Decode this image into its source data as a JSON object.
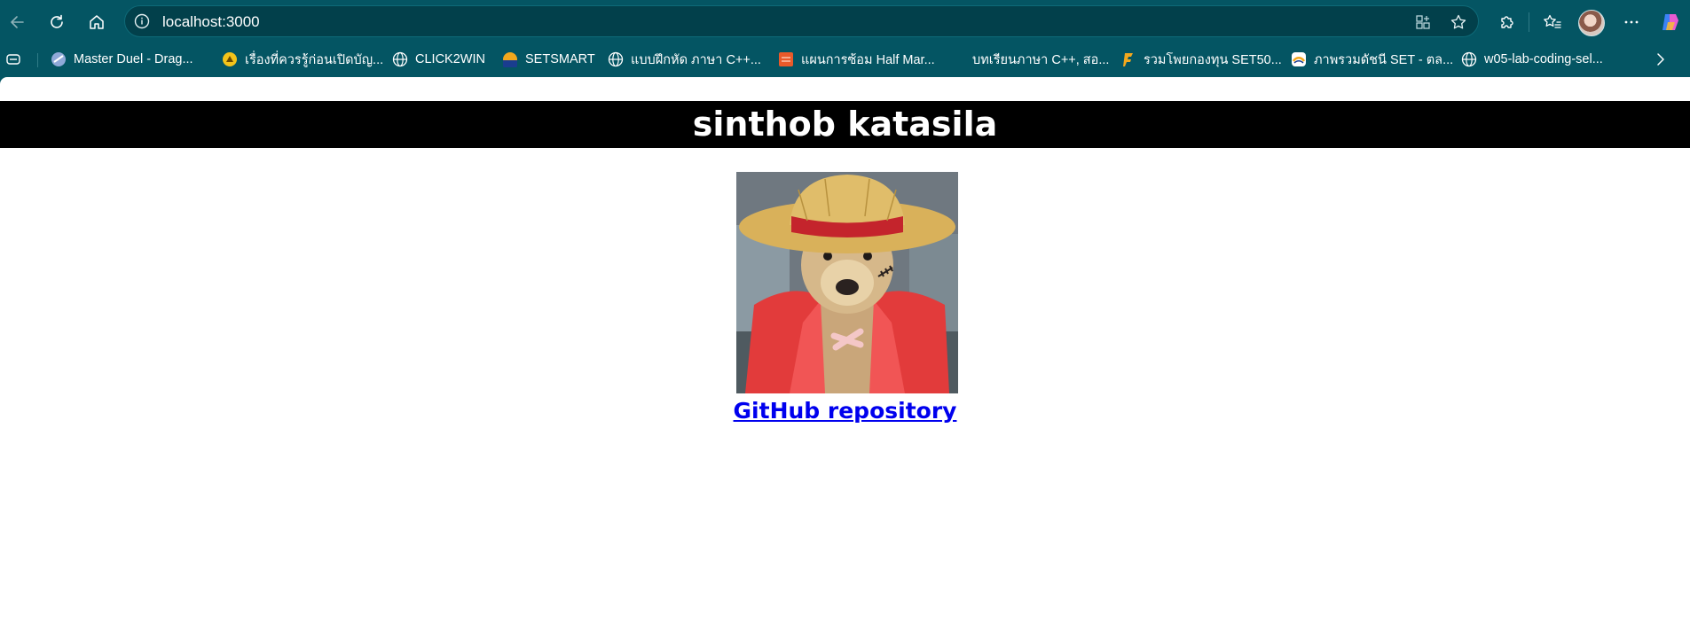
{
  "browser": {
    "url": "localhost:3000",
    "bookmarks": [
      {
        "label": "Master Duel - Drag...",
        "icon": "game-icon"
      },
      {
        "label": "เรื่องที่ควรรู้ก่อนเปิดบัญ...",
        "icon": "bank-icon"
      },
      {
        "label": "CLICK2WIN",
        "icon": "globe-icon"
      },
      {
        "label": "SETSMART",
        "icon": "set-icon"
      },
      {
        "label": "แบบฝึกหัด ภาษา C++...",
        "icon": "globe-icon"
      },
      {
        "label": "แผนการซ้อม Half Mar...",
        "icon": "plan-icon"
      },
      {
        "label": "บทเรียนภาษา C++, สอ...",
        "icon": "blank-icon"
      },
      {
        "label": "รวมโพยกองทุน SET50...",
        "icon": "fund-icon"
      },
      {
        "label": "ภาพรวมดัชนี SET - ตล...",
        "icon": "set-index-icon"
      },
      {
        "label": "w05-lab-coding-sel...",
        "icon": "globe-icon"
      }
    ]
  },
  "page": {
    "title": "sinthob katasila",
    "link_text": "GitHub repository",
    "image_alt": "dog dressed as straw-hat pirate"
  },
  "colors": {
    "chrome": "#045563",
    "header_bg": "#000000",
    "link": "#0000ee"
  }
}
